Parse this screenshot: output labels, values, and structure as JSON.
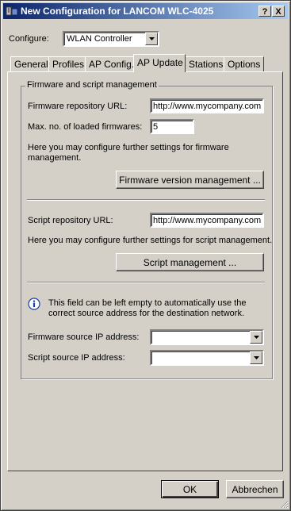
{
  "window": {
    "title": "New Configuration for LANCOM WLC-4025",
    "help_btn": "?",
    "close_btn": "X"
  },
  "configure": {
    "label": "Configure:",
    "value": "WLAN Controller"
  },
  "tabs": [
    {
      "label": "General",
      "active": false
    },
    {
      "label": "Profiles",
      "active": false
    },
    {
      "label": "AP Config.",
      "active": false
    },
    {
      "label": "AP Update",
      "active": true
    },
    {
      "label": "Stations",
      "active": false
    },
    {
      "label": "Options",
      "active": false
    }
  ],
  "group": {
    "title": "Firmware and script management",
    "firmware_url_label": "Firmware repository URL:",
    "firmware_url_value": "http://www.mycompany.com",
    "max_fw_label": "Max. no. of loaded firmwares:",
    "max_fw_value": "5",
    "fw_hint": "Here you may configure further settings for firmware management.",
    "fw_button": "Firmware version management ...",
    "script_url_label": "Script repository URL:",
    "script_url_value": "http://www.mycompany.com",
    "script_hint": "Here you may configure further settings for script management.",
    "script_button": "Script management ...",
    "info_text": "This field can be left empty to automatically use the correct source address for the destination network.",
    "fw_src_label": "Firmware source IP address:",
    "fw_src_value": "",
    "script_src_label": "Script source IP address:",
    "script_src_value": ""
  },
  "footer": {
    "ok": "OK",
    "cancel": "Abbrechen"
  }
}
